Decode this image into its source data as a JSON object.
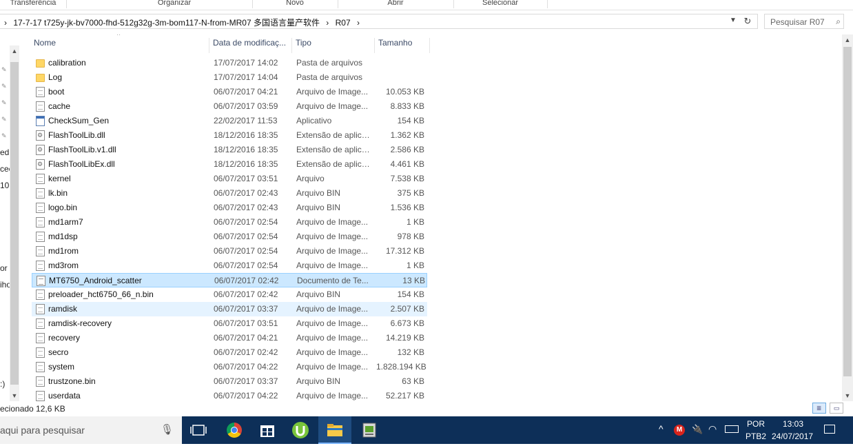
{
  "ribbon": {
    "groups": [
      "Transferência",
      "Organizar",
      "Novo",
      "Abrir",
      "Selecionar"
    ]
  },
  "address": {
    "crumbs": [
      "›",
      "17-7-17 t725y-jk-bv7000-fhd-512g32g-3m-bom117-N-from-MR07 多国语言量产软件",
      "›",
      "R07",
      "›"
    ]
  },
  "search": {
    "placeholder": "Pesquisar R07"
  },
  "nav_fragments": [
    "ed",
    "cee",
    "10",
    "or",
    "iho",
    ":)"
  ],
  "columns": {
    "name": "Nome",
    "date": "Data de modificaç...",
    "type": "Tipo",
    "size": "Tamanho"
  },
  "files": [
    {
      "name": "calibration",
      "date": "17/07/2017 14:02",
      "type": "Pasta de arquivos",
      "size": "",
      "icon": "folder-icon"
    },
    {
      "name": "Log",
      "date": "17/07/2017 14:04",
      "type": "Pasta de arquivos",
      "size": "",
      "icon": "folder-icon"
    },
    {
      "name": "boot",
      "date": "06/07/2017 04:21",
      "type": "Arquivo de Image...",
      "size": "10.053 KB",
      "icon": "file-icon"
    },
    {
      "name": "cache",
      "date": "06/07/2017 03:59",
      "type": "Arquivo de Image...",
      "size": "8.833 KB",
      "icon": "file-icon"
    },
    {
      "name": "CheckSum_Gen",
      "date": "22/02/2017 11:53",
      "type": "Aplicativo",
      "size": "154 KB",
      "icon": "app-icon"
    },
    {
      "name": "FlashToolLib.dll",
      "date": "18/12/2016 18:35",
      "type": "Extensão de aplica...",
      "size": "1.362 KB",
      "icon": "dll-icon"
    },
    {
      "name": "FlashToolLib.v1.dll",
      "date": "18/12/2016 18:35",
      "type": "Extensão de aplica...",
      "size": "2.586 KB",
      "icon": "dll-icon"
    },
    {
      "name": "FlashToolLibEx.dll",
      "date": "18/12/2016 18:35",
      "type": "Extensão de aplica...",
      "size": "4.461 KB",
      "icon": "dll-icon"
    },
    {
      "name": "kernel",
      "date": "06/07/2017 03:51",
      "type": "Arquivo",
      "size": "7.538 KB",
      "icon": "blank-file-icon"
    },
    {
      "name": "lk.bin",
      "date": "06/07/2017 02:43",
      "type": "Arquivo BIN",
      "size": "375 KB",
      "icon": "blank-file-icon"
    },
    {
      "name": "logo.bin",
      "date": "06/07/2017 02:43",
      "type": "Arquivo BIN",
      "size": "1.536 KB",
      "icon": "blank-file-icon"
    },
    {
      "name": "md1arm7",
      "date": "06/07/2017 02:54",
      "type": "Arquivo de Image...",
      "size": "1 KB",
      "icon": "file-icon"
    },
    {
      "name": "md1dsp",
      "date": "06/07/2017 02:54",
      "type": "Arquivo de Image...",
      "size": "978 KB",
      "icon": "file-icon"
    },
    {
      "name": "md1rom",
      "date": "06/07/2017 02:54",
      "type": "Arquivo de Image...",
      "size": "17.312 KB",
      "icon": "file-icon"
    },
    {
      "name": "md3rom",
      "date": "06/07/2017 02:54",
      "type": "Arquivo de Image...",
      "size": "1 KB",
      "icon": "file-icon"
    },
    {
      "name": "MT6750_Android_scatter",
      "date": "06/07/2017 02:42",
      "type": "Documento de Te...",
      "size": "13 KB",
      "icon": "text-file-icon",
      "state": "selected"
    },
    {
      "name": "preloader_hct6750_66_n.bin",
      "date": "06/07/2017 02:42",
      "type": "Arquivo BIN",
      "size": "154 KB",
      "icon": "blank-file-icon"
    },
    {
      "name": "ramdisk",
      "date": "06/07/2017 03:37",
      "type": "Arquivo de Image...",
      "size": "2.507 KB",
      "icon": "file-icon",
      "state": "hover"
    },
    {
      "name": "ramdisk-recovery",
      "date": "06/07/2017 03:51",
      "type": "Arquivo de Image...",
      "size": "6.673 KB",
      "icon": "file-icon"
    },
    {
      "name": "recovery",
      "date": "06/07/2017 04:21",
      "type": "Arquivo de Image...",
      "size": "14.219 KB",
      "icon": "file-icon"
    },
    {
      "name": "secro",
      "date": "06/07/2017 02:42",
      "type": "Arquivo de Image...",
      "size": "132 KB",
      "icon": "file-icon"
    },
    {
      "name": "system",
      "date": "06/07/2017 04:22",
      "type": "Arquivo de Image...",
      "size": "1.828.194 KB",
      "icon": "file-icon"
    },
    {
      "name": "trustzone.bin",
      "date": "06/07/2017 03:37",
      "type": "Arquivo BIN",
      "size": "63 KB",
      "icon": "blank-file-icon"
    },
    {
      "name": "userdata",
      "date": "06/07/2017 04:22",
      "type": "Arquivo de Image...",
      "size": "52.217 KB",
      "icon": "file-icon"
    }
  ],
  "status": {
    "text": "ecionado  12,6 KB"
  },
  "taskbar": {
    "search_placeholder": "aqui para pesquisar",
    "lang": "POR",
    "layout": "PTB2",
    "time": "13:03",
    "date": "24/07/2017"
  },
  "colors": {
    "selection": "#cce8ff",
    "hover": "#e5f3ff",
    "taskbar": "#0d2f58",
    "folder": "#ffd766"
  }
}
